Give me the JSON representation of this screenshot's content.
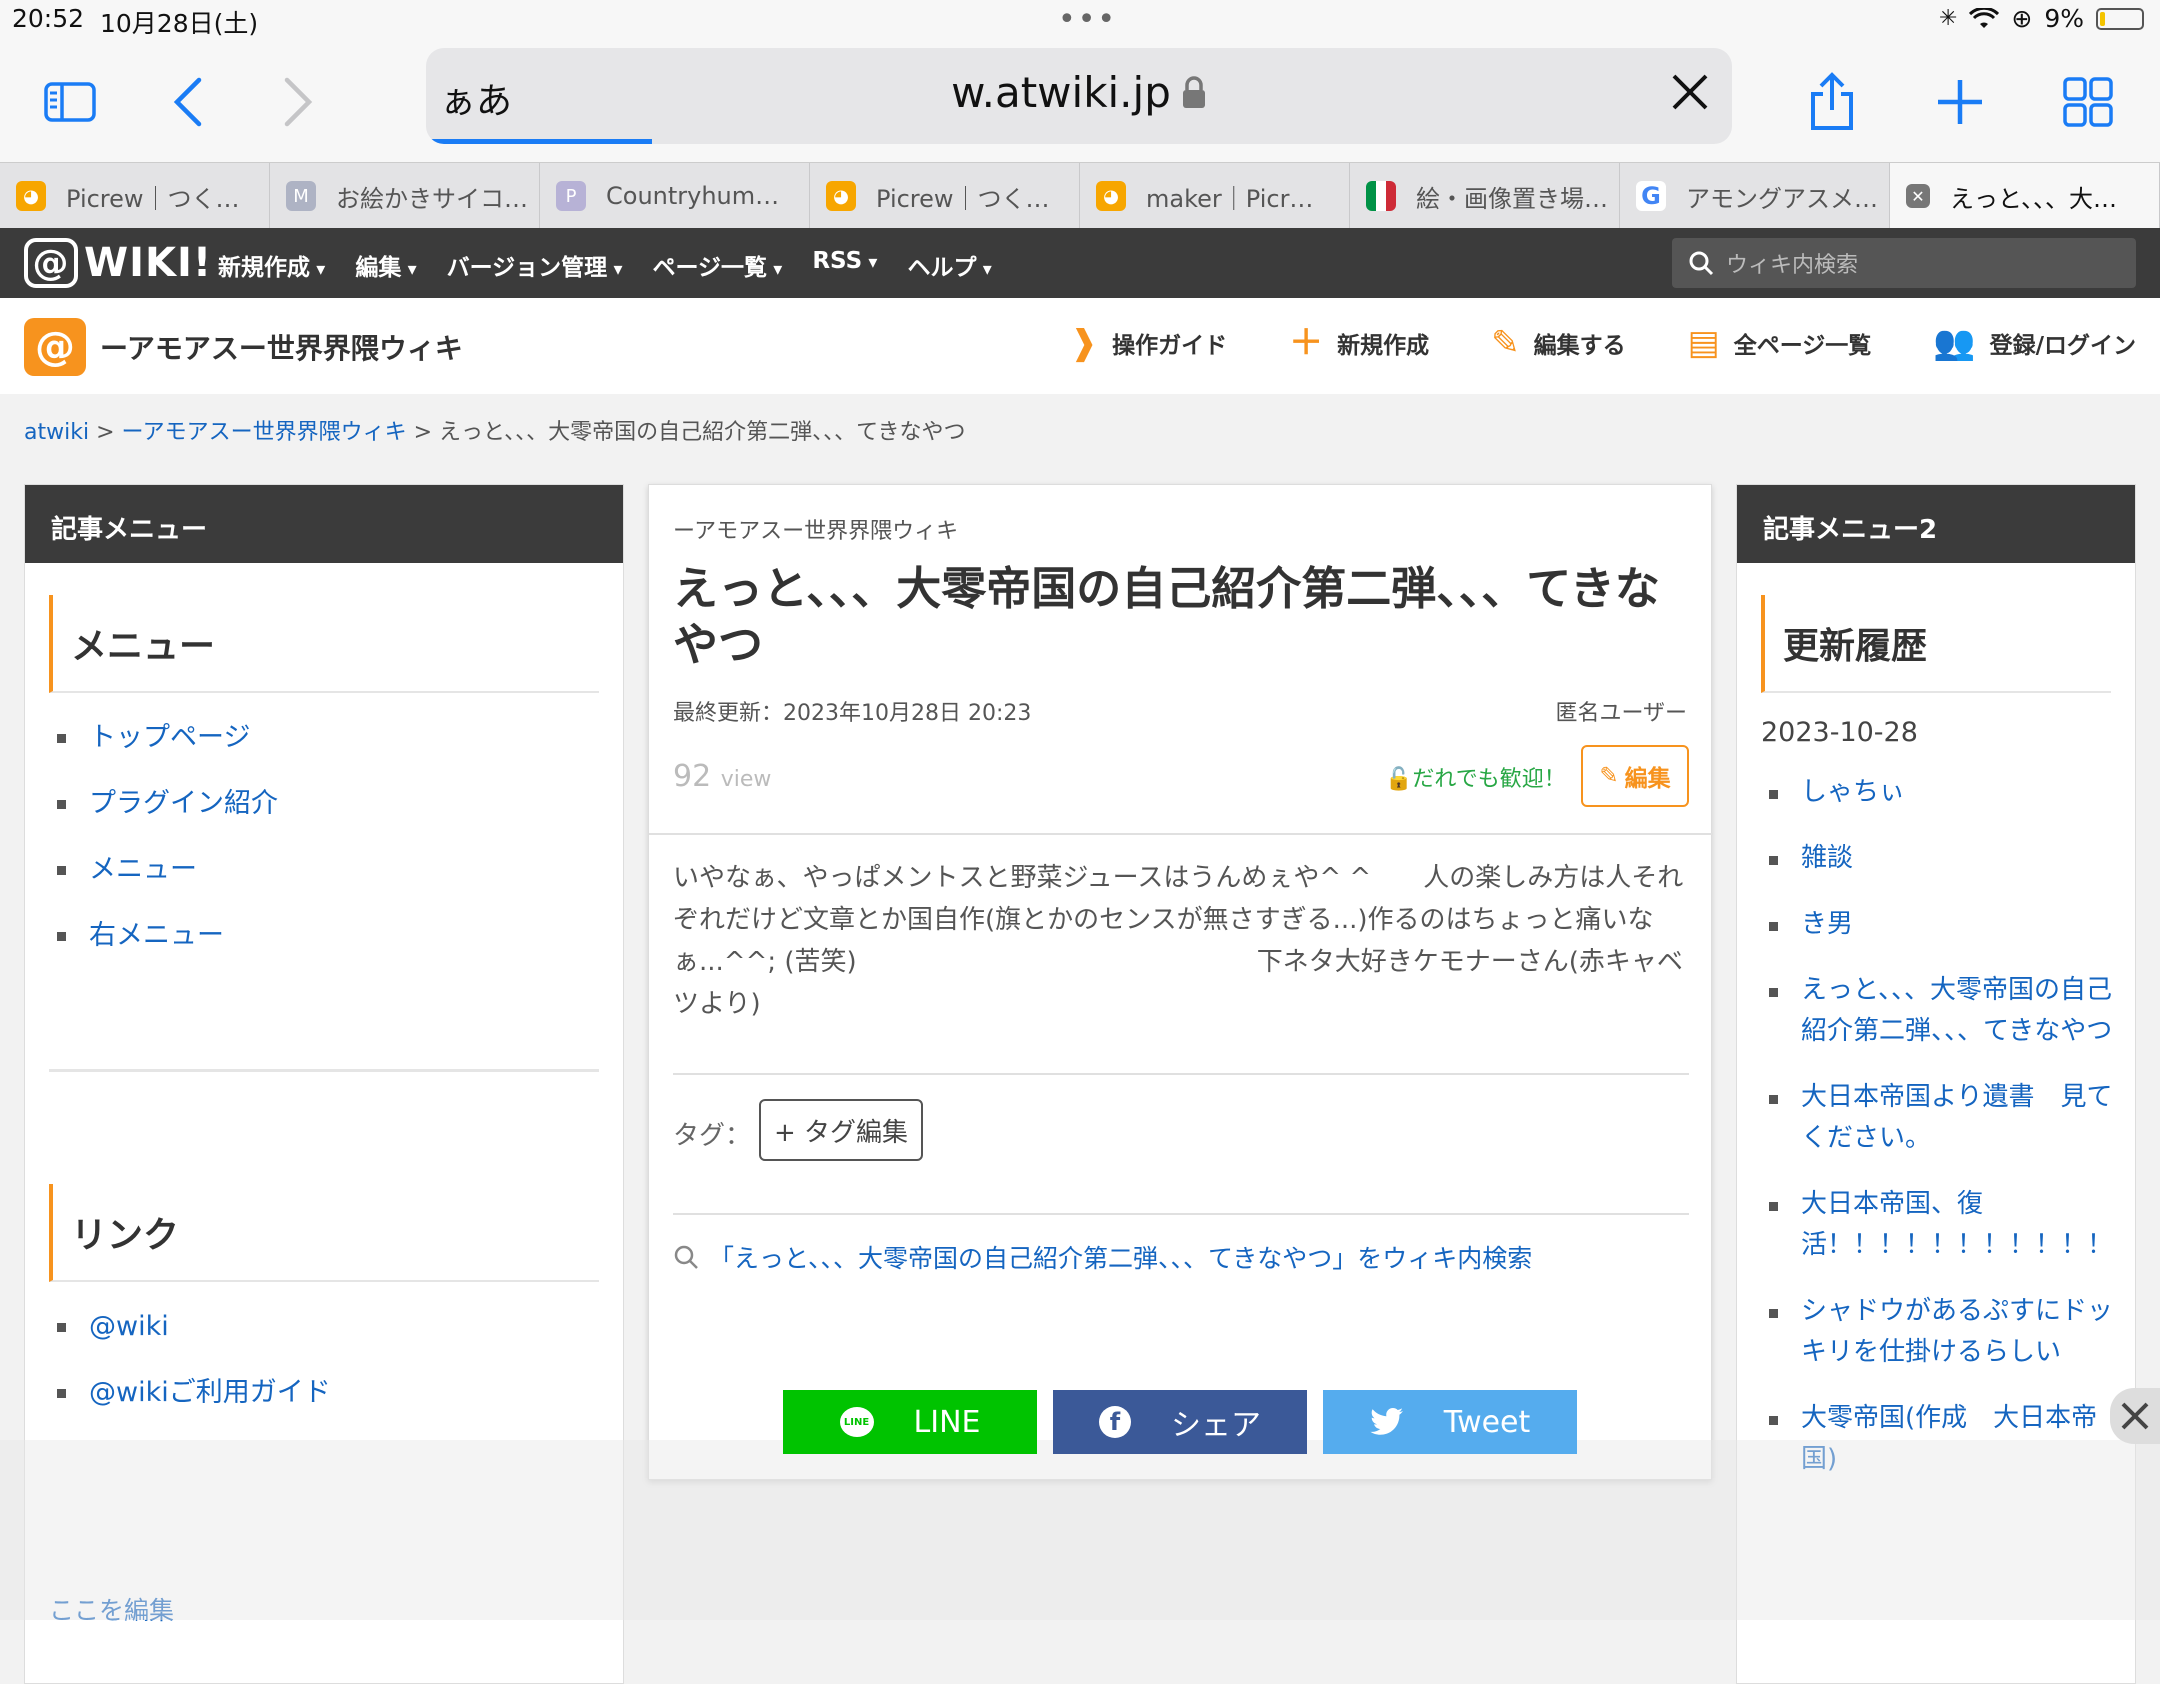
{
  "status": {
    "time": "20:52",
    "date": "10月28日(土)",
    "battery": "9%"
  },
  "address": {
    "aa": "ぁあ",
    "url": "w.atwiki.jp"
  },
  "tabs": [
    {
      "label": "Picrew｜つく…",
      "icon": "picrew-icon",
      "color": "#f7a600"
    },
    {
      "label": "お絵かきサイコ…",
      "icon": "m-icon",
      "color": "#aeb3c4"
    },
    {
      "label": "Countryhum…",
      "icon": "p-icon",
      "color": "#b7b2d6"
    },
    {
      "label": "Picrew｜つく…",
      "icon": "picrew-icon",
      "color": "#f7a600"
    },
    {
      "label": "maker｜Picr…",
      "icon": "picrew-icon",
      "color": "#f7a600"
    },
    {
      "label": "絵・画像置き場…",
      "icon": "italy-flag-icon",
      "color": "#009246"
    },
    {
      "label": "アモングアスメ…",
      "icon": "google-icon",
      "color": "#4285f4"
    },
    {
      "label": "えっと、、、大…",
      "icon": "close-icon",
      "color": "#666666"
    }
  ],
  "wikinav": {
    "logo": "WIKI",
    "menu": [
      "新規作成",
      "編集",
      "バージョン管理",
      "ページ一覧",
      "RSS",
      "ヘルプ"
    ],
    "search_placeholder": "ウィキ内検索"
  },
  "site": {
    "title": "ーアモアスー世界界隈ウィキ",
    "actions": [
      "操作ガイド",
      "新規作成",
      "編集する",
      "全ページ一覧",
      "登録/ログイン"
    ]
  },
  "breadcrumb": {
    "root": "atwiki",
    "sep": " > ",
    "wiki": "ーアモアスー世界界隈ウィキ",
    "page": "えっと、、、大零帝国の自己紹介第二弾、、、てきなやつ"
  },
  "left": {
    "bar": "記事メニュー",
    "menu_title": "メニュー",
    "menu": [
      "トップページ",
      "プラグイン紹介",
      "メニュー",
      "右メニュー"
    ],
    "link_title": "リンク",
    "links": [
      "@wiki",
      "@wikiご利用ガイド"
    ],
    "edit_here": "ここを編集"
  },
  "article": {
    "site": "ーアモアスー世界界隈ウィキ",
    "title": "えっと、、、大零帝国の自己紹介第二弾、、、てきなやつ",
    "updated": "最終更新：2023年10月28日 20:23",
    "author": "匿名ユーザー",
    "views_num": "92",
    "views_unit": "view",
    "welcome": "だれでも歓迎！",
    "edit": "編集",
    "body_1": "いやなぁ、やっぱメントスと野菜ジュースはうんめぇや^ ^　　人の楽しみ方は人それぞれだけど文章とか国自作(旗とかのセンスが無さすぎる...)作るのはちょっと痛いなぁ...^^; (苦笑)",
    "body_2": "下ネタ大好きケモナーさん(赤キャベツより)",
    "tag_label": "タグ：",
    "tag_edit": "+ タグ編集",
    "search": "「えっと、、、大零帝国の自己紹介第二弾、、、てきなやつ」をウィキ内検索"
  },
  "right": {
    "bar": "記事メニュー2",
    "title": "更新履歴",
    "date": "2023-10-28",
    "links": [
      "しゃちぃ",
      "雑談",
      "き男",
      "えっと、、、大零帝国の自己紹介第二弾、、、てきなやつ",
      "大日本帝国より遺書　見てください。",
      "大日本帝国、復活！！！！！！！！！！！",
      "シャドウがあるぷすにドッキリを仕掛けるらしい",
      "大零帝国(作成　大日本帝国)"
    ]
  },
  "share": {
    "line": "LINE",
    "facebook": "シェア",
    "twitter": "Tweet",
    "line_color": "#00c300",
    "fb_color": "#3b5998",
    "tw_color": "#55acee"
  }
}
